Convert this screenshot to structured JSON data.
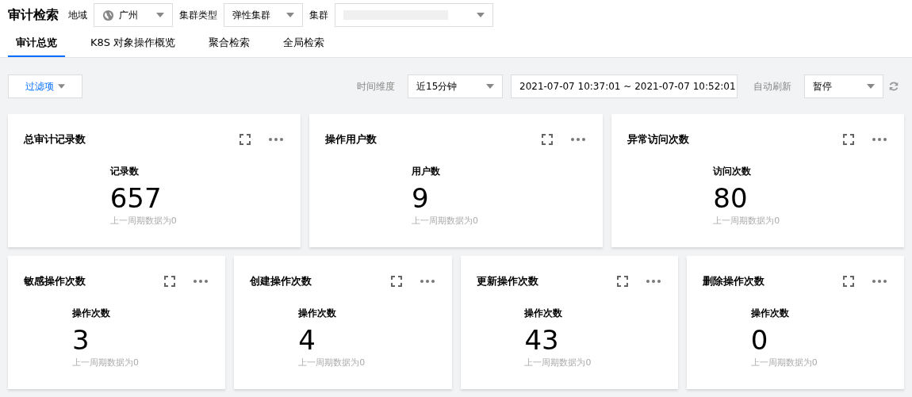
{
  "page_title": "审计检索",
  "filters": [
    {
      "label": "地域",
      "kind": "region",
      "value": "广州"
    },
    {
      "label": "集群类型",
      "kind": "plain",
      "value": "弹性集群"
    },
    {
      "label": "集群",
      "kind": "blurred"
    }
  ],
  "tabs": [
    {
      "label": "审计总览",
      "selected": true
    },
    {
      "label": "K8S 对象操作概览",
      "selected": false
    },
    {
      "label": "聚合检索",
      "selected": false
    },
    {
      "label": "全局检索",
      "selected": false
    }
  ],
  "toolbar": {
    "filter_button": "过滤项",
    "time_label": "时间维度",
    "time_range": "近15分钟",
    "date_range": "2021-07-07 10:37:01 ~ 2021-07-07 10:52:01",
    "refresh_label": "自动刷新",
    "refresh_value": "暂停"
  },
  "card_rows": [
    [
      {
        "title": "总审计记录数",
        "metric": "记录数",
        "value": "657",
        "note": "上一周期数据为0"
      },
      {
        "title": "操作用户数",
        "metric": "用户数",
        "value": "9",
        "note": "上一周期数据为0"
      },
      {
        "title": "异常访问次数",
        "metric": "访问次数",
        "value": "80",
        "note": "上一周期数据为0"
      }
    ],
    [
      {
        "title": "敏感操作次数",
        "metric": "操作次数",
        "value": "3",
        "note": "上一周期数据为0"
      },
      {
        "title": "创建操作次数",
        "metric": "操作次数",
        "value": "4",
        "note": "上一周期数据为0"
      },
      {
        "title": "更新操作次数",
        "metric": "操作次数",
        "value": "43",
        "note": "上一周期数据为0"
      },
      {
        "title": "删除操作次数",
        "metric": "操作次数",
        "value": "0",
        "note": "上一周期数据为0"
      }
    ]
  ]
}
